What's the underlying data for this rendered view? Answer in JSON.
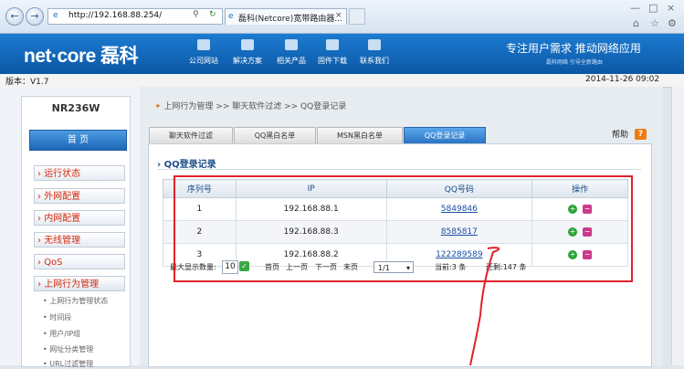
{
  "browser": {
    "url": "http://192.168.88.254/",
    "tab_title": "磊科(Netcore)宽带路由器..."
  },
  "header": {
    "logo": "net·core 磊科",
    "nav": [
      "公司网站",
      "解决方案",
      "相关产品",
      "固件下载",
      "联系我们"
    ],
    "slogan": "专注用户需求  推动网络应用",
    "slogan_sub": "磊科网络 引导全新路由"
  },
  "version_bar": {
    "version": "版本：V1.7",
    "datetime": "2014-11-26 09:02"
  },
  "sidebar": {
    "model": "NR236W",
    "home": "首 页",
    "menu": [
      "运行状态",
      "外网配置",
      "内网配置",
      "无线管理",
      "QoS",
      "上网行为管理"
    ],
    "submenu": [
      "上网行为管理状态",
      "时间段",
      "用户/IP组",
      "网址分类管理",
      "URL过滤管理"
    ]
  },
  "main": {
    "breadcrumb": "上网行为管理  >>  聊天软件过滤  >>  QQ登录记录",
    "tabs": [
      "聊天软件过滤",
      "QQ黑白名单",
      "MSN黑白名单",
      "QQ登录记录"
    ],
    "help": "帮助",
    "section_title": "QQ登录记录",
    "table": {
      "headers": [
        "序列号",
        "IP",
        "QQ号码",
        "操作"
      ],
      "rows": [
        {
          "seq": "1",
          "ip": "192.168.88.1",
          "qq": "5849846"
        },
        {
          "seq": "2",
          "ip": "192.168.88.3",
          "qq": "8585817"
        },
        {
          "seq": "3",
          "ip": "192.168.88.2",
          "qq": "122289589"
        }
      ]
    },
    "pager": {
      "max_label": "最大显示数量:",
      "max_value": "10",
      "first": "首页",
      "prev": "上一页",
      "next": "下一页",
      "last": "末页",
      "page": "1/1",
      "current": "当前:3 条",
      "total": "还剩:147 条"
    }
  },
  "colors": {
    "header_blue": "#0c57a6",
    "menu_red": "#d52b10",
    "annotation_red": "#e0222a",
    "link_blue": "#1b4fa8"
  }
}
